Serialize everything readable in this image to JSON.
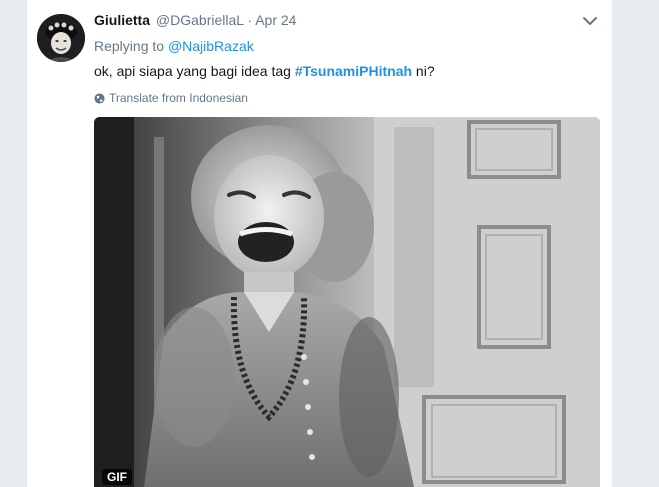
{
  "tweet": {
    "author_name": "Giulietta",
    "author_handle": "@DGabriellaL",
    "separator": "·",
    "date": "Apr 24",
    "replying_prefix": "Replying to",
    "replying_mention": "@NajibRazak",
    "text_before": "ok, api siapa yang bagi idea tag",
    "hashtag": "#TsunamiPHitnah",
    "text_after": "ni?",
    "translate_label": "Translate from Indonesian",
    "media_badge": "GIF"
  },
  "icons": {
    "menu": "chevron-down-icon",
    "translate": "globe-icon"
  },
  "colors": {
    "link": "#1b95e0",
    "secondary_text": "#657786",
    "primary_text": "#14171a",
    "page_background": "#e6ecf0"
  }
}
